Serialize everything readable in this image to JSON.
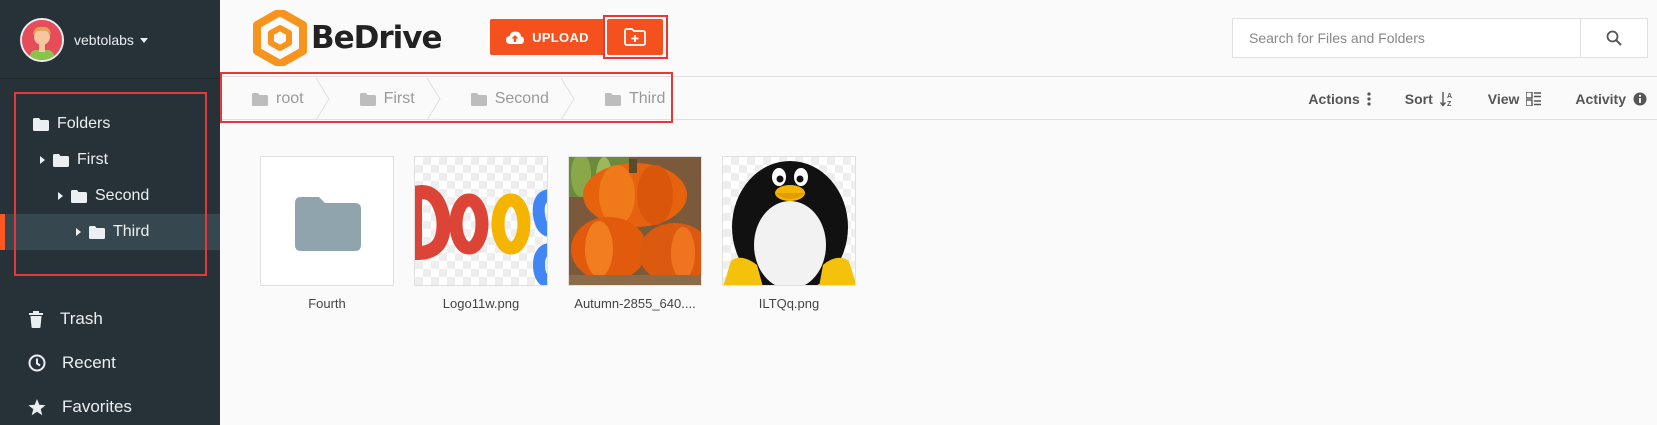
{
  "user": {
    "name": "vebtolabs"
  },
  "sidebar": {
    "tree_root": "Folders",
    "tree": [
      {
        "label": "First"
      },
      {
        "label": "Second"
      },
      {
        "label": "Third"
      }
    ],
    "nav": [
      {
        "label": "Trash",
        "icon": "trash-icon"
      },
      {
        "label": "Recent",
        "icon": "clock-icon"
      },
      {
        "label": "Favorites",
        "icon": "star-icon"
      }
    ]
  },
  "header": {
    "logo_text": "BeDrive",
    "upload_label": "UPLOAD",
    "search_placeholder": "Search for Files and Folders"
  },
  "breadcrumb": [
    "root",
    "First",
    "Second",
    "Third"
  ],
  "toolbar": {
    "actions": "Actions",
    "sort": "Sort",
    "view": "View",
    "activity": "Activity"
  },
  "files": [
    {
      "name": "Fourth",
      "type": "folder"
    },
    {
      "name": "Logo11w.png",
      "type": "image"
    },
    {
      "name": "Autumn-2855_640....",
      "type": "image"
    },
    {
      "name": "ILTQq.png",
      "type": "image"
    }
  ],
  "colors": {
    "accent": "#f4511e",
    "sidebar": "#263238",
    "highlight": "#e53935"
  }
}
